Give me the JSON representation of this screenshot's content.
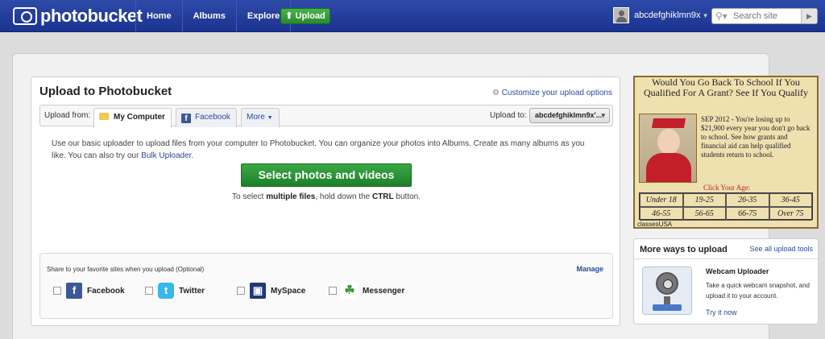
{
  "header": {
    "logo": "photobucket",
    "nav": [
      "Home",
      "Albums",
      "Explore"
    ],
    "upload_label": "Upload",
    "username": "abcdefghiklmn9x",
    "search_placeholder": "Search site"
  },
  "panel": {
    "title": "Upload to Photobucket",
    "customize_link": "Customize your upload options",
    "upload_from_label": "Upload from:",
    "tabs": [
      "My Computer",
      "Facebook",
      "More"
    ],
    "upload_to_label": "Upload to:",
    "album_value": "abcdefghiklmn9x'...",
    "description": "Use our basic uploader to upload files from your computer to Photobucket. You can organize your photos into Albums. Create as many albums as you like. You can also try our",
    "bulk_link": "Bulk Uploader",
    "select_button": "Select photos and videos",
    "hint_pre": "To select",
    "hint_bold1": "multiple files",
    "hint_mid": ", hold down the",
    "hint_bold2": "CTRL",
    "hint_post": "button."
  },
  "share": {
    "label": "Share to your favorite sites when you upload (Optional)",
    "manage": "Manage",
    "services": [
      "Facebook",
      "Twitter",
      "MySpace",
      "Messenger"
    ]
  },
  "ad": {
    "headline": "Would You Go Back To School If You Qualified For A Grant? See If You Qualify",
    "copy": "SEP 2012 - You're losing up to $21,900 every year you don't go back to school. See how grants and financial aid can help qualified students return to school.",
    "click": "Click Your Age:",
    "ages": [
      "Under 18",
      "19-25",
      "26-35",
      "36-45",
      "46-55",
      "56-65",
      "66-75",
      "Over 75"
    ],
    "brand": "classesUSA"
  },
  "ways": {
    "title": "More ways to upload",
    "link": "See all upload tools",
    "tool_title": "Webcam Uploader",
    "tool_text": "Take a quick webcam snapshot, and upload it to your account.",
    "tool_link": "Try it now"
  },
  "colors": {
    "header_blue": "#1b3390",
    "link_blue": "#2a4aa0",
    "green_button": "#2a8a2e"
  }
}
